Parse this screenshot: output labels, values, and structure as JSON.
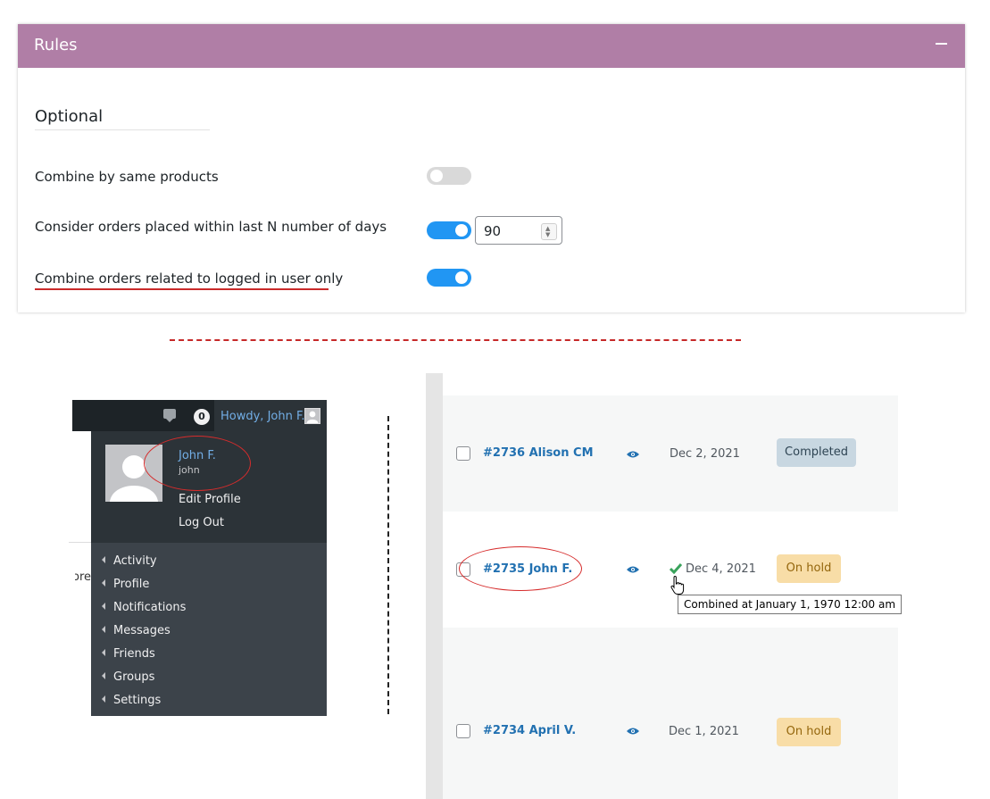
{
  "rules": {
    "title": "Rules",
    "collapse_icon": "minus-icon",
    "section_title": "Optional",
    "options": [
      {
        "label": "Combine by same products",
        "enabled": false
      },
      {
        "label": "Consider orders placed within last N number of days",
        "enabled": true,
        "days_value": "90"
      },
      {
        "label": "Combine orders related to logged in user only",
        "enabled": true,
        "highlighted": true
      }
    ]
  },
  "adminbar": {
    "comment_icon": "comment-bubble-icon",
    "notification_count": "0",
    "howdy": "Howdy, John F."
  },
  "user_dropdown": {
    "display_name": "John F.",
    "username": "john",
    "edit_profile": "Edit Profile",
    "log_out": "Log Out",
    "menu": [
      "Activity",
      "Profile",
      "Notifications",
      "Messages",
      "Friends",
      "Groups",
      "Settings"
    ],
    "background_text": "ore"
  },
  "orders": [
    {
      "number_name": "#2736 Alison CM",
      "date": "Dec 2, 2021",
      "status": "Completed",
      "combined": false
    },
    {
      "number_name": "#2735 John F.",
      "date": "Dec 4, 2021",
      "status": "On hold",
      "combined": true,
      "tooltip": "Combined at January 1, 1970 12:00 am"
    },
    {
      "number_name": "#2734 April V.",
      "date": "Dec 1, 2021",
      "status": "On hold",
      "combined": false
    }
  ],
  "colors": {
    "header_bg": "#b07ea6",
    "toggle_on": "#2196f3",
    "toggle_off": "#d9d9d9",
    "annotation_red": "#d62c2c",
    "link_blue": "#2271b1"
  }
}
